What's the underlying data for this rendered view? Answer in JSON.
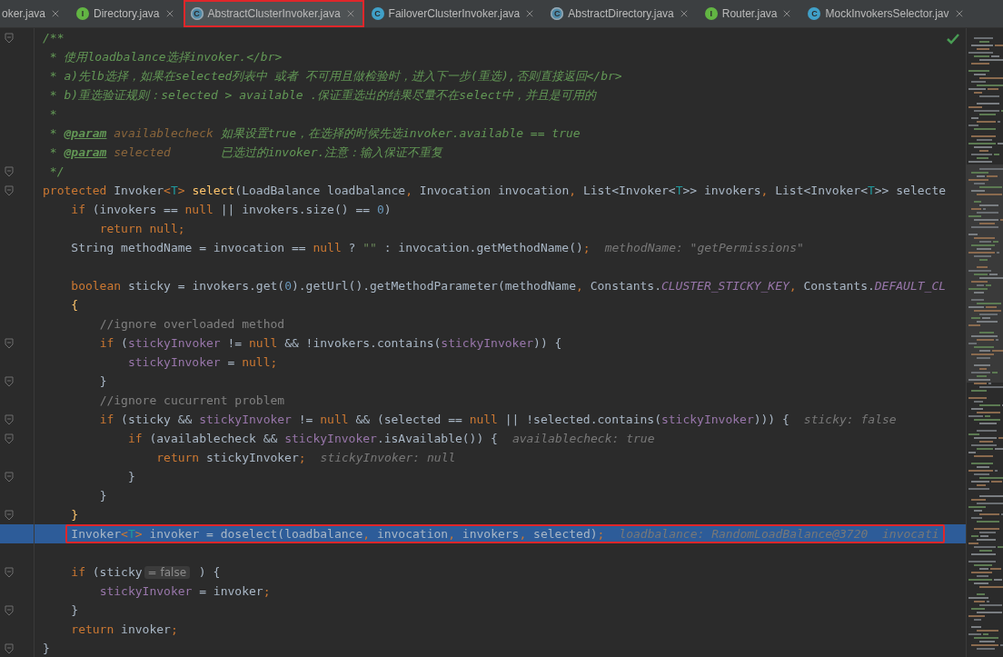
{
  "tabs": [
    {
      "label": "oker.java",
      "selected": false,
      "annotated": false
    },
    {
      "label": "Directory.java",
      "selected": false,
      "annotated": false,
      "icon": {
        "kind": "interface",
        "letter": "I"
      }
    },
    {
      "label": "AbstractClusterInvoker.java",
      "selected": true,
      "annotated": true,
      "icon": {
        "kind": "abstract-class",
        "letter": "C"
      }
    },
    {
      "label": "FailoverClusterInvoker.java",
      "selected": false,
      "annotated": false,
      "icon": {
        "kind": "class",
        "letter": "C"
      }
    },
    {
      "label": "AbstractDirectory.java",
      "selected": false,
      "annotated": false,
      "icon": {
        "kind": "abstract-class",
        "letter": "C"
      }
    },
    {
      "label": "Router.java",
      "selected": false,
      "annotated": false,
      "icon": {
        "kind": "interface",
        "letter": "I"
      }
    },
    {
      "label": "MockInvokersSelector.jav",
      "selected": false,
      "annotated": false,
      "icon": {
        "kind": "class",
        "letter": "C"
      }
    }
  ],
  "editor": {
    "analysis_ok": true,
    "lines": [
      {
        "fold": true,
        "current": false,
        "annotated": false,
        "tokens": [
          {
            "kind": "doc",
            "text": "/**"
          }
        ]
      },
      {
        "fold": false,
        "current": false,
        "annotated": false,
        "tokens": [
          {
            "kind": "doc",
            "text": " * 使用loadbalance选择invoker.</br>"
          }
        ]
      },
      {
        "fold": false,
        "current": false,
        "annotated": false,
        "tokens": [
          {
            "kind": "doc",
            "text": " * a)先lb选择，如果在selected列表中 或者 不可用且做检验时，进入下一步(重选),否则直接返回</br>"
          }
        ]
      },
      {
        "fold": false,
        "current": false,
        "annotated": false,
        "tokens": [
          {
            "kind": "doc",
            "text": " * b)重选验证规则：selected > available .保证重选出的结果尽量不在select中，并且是可用的"
          }
        ]
      },
      {
        "fold": false,
        "current": false,
        "annotated": false,
        "tokens": [
          {
            "kind": "doc",
            "text": " *"
          }
        ]
      },
      {
        "fold": false,
        "current": false,
        "annotated": false,
        "tokens": [
          {
            "kind": "doc",
            "text": " * "
          },
          {
            "kind": "doctag",
            "text": "@param"
          },
          {
            "kind": "docparam",
            "text": " availablecheck"
          },
          {
            "kind": "doc",
            "text": " 如果设置true，在选择的时候先选invoker.available == true"
          }
        ]
      },
      {
        "fold": false,
        "current": false,
        "annotated": false,
        "tokens": [
          {
            "kind": "doc",
            "text": " * "
          },
          {
            "kind": "doctag",
            "text": "@param"
          },
          {
            "kind": "docparam",
            "text": " selected"
          },
          {
            "kind": "doc",
            "text": "       已选过的invoker.注意：输入保证不重复"
          }
        ]
      },
      {
        "fold": true,
        "current": false,
        "annotated": false,
        "tokens": [
          {
            "kind": "doc",
            "text": " */"
          }
        ]
      },
      {
        "fold": true,
        "current": false,
        "annotated": false,
        "tokens": [
          {
            "kind": "kw",
            "text": "protected "
          },
          {
            "kind": "plain",
            "text": "Invoker"
          },
          {
            "kind": "kw",
            "text": "<"
          },
          {
            "kind": "tp",
            "text": "T"
          },
          {
            "kind": "kw",
            "text": "> "
          },
          {
            "kind": "method",
            "text": "select"
          },
          {
            "kind": "plain",
            "text": "(LoadBalance loadbalance"
          },
          {
            "kind": "kw",
            "text": ", "
          },
          {
            "kind": "plain",
            "text": "Invocation invocation"
          },
          {
            "kind": "kw",
            "text": ", "
          },
          {
            "kind": "plain",
            "text": "List<Invoker<"
          },
          {
            "kind": "tp",
            "text": "T"
          },
          {
            "kind": "plain",
            "text": ">> invokers"
          },
          {
            "kind": "kw",
            "text": ", "
          },
          {
            "kind": "plain",
            "text": "List<Invoker<"
          },
          {
            "kind": "tp",
            "text": "T"
          },
          {
            "kind": "plain",
            "text": ">> selecte"
          }
        ]
      },
      {
        "fold": false,
        "current": false,
        "annotated": false,
        "tokens": [
          {
            "kind": "kw",
            "text": "    if "
          },
          {
            "kind": "plain",
            "text": "(invokers == "
          },
          {
            "kind": "kw",
            "text": "null"
          },
          {
            "kind": "plain",
            "text": " || invokers.size() == "
          },
          {
            "kind": "num",
            "text": "0"
          },
          {
            "kind": "plain",
            "text": ")"
          }
        ]
      },
      {
        "fold": false,
        "current": false,
        "annotated": false,
        "tokens": [
          {
            "kind": "kw",
            "text": "        return null;"
          }
        ]
      },
      {
        "fold": false,
        "current": false,
        "annotated": false,
        "tokens": [
          {
            "kind": "plain",
            "text": "    String methodName = invocation == "
          },
          {
            "kind": "kw",
            "text": "null"
          },
          {
            "kind": "plain",
            "text": " ? "
          },
          {
            "kind": "str",
            "text": "\"\""
          },
          {
            "kind": "plain",
            "text": " : invocation.getMethodName()"
          },
          {
            "kind": "kw",
            "text": ";"
          },
          {
            "kind": "hint",
            "text": "methodName: \"getPermissions\""
          }
        ]
      },
      {
        "fold": false,
        "current": false,
        "annotated": false
      },
      {
        "fold": false,
        "current": false,
        "annotated": false,
        "tokens": [
          {
            "kind": "kw",
            "text": "    boolean "
          },
          {
            "kind": "plain",
            "text": "sticky = invokers.get("
          },
          {
            "kind": "num",
            "text": "0"
          },
          {
            "kind": "plain",
            "text": ").getUrl().getMethodParameter(methodName"
          },
          {
            "kind": "kw",
            "text": ", "
          },
          {
            "kind": "plain",
            "text": "Constants."
          },
          {
            "kind": "static",
            "text": "CLUSTER_STICKY_KEY"
          },
          {
            "kind": "kw",
            "text": ", "
          },
          {
            "kind": "plain",
            "text": "Constants."
          },
          {
            "kind": "static",
            "text": "DEFAULT_CL"
          }
        ]
      },
      {
        "fold": false,
        "current": false,
        "annotated": false,
        "tokens": [
          {
            "kind": "method",
            "text": "    {"
          }
        ]
      },
      {
        "fold": false,
        "current": false,
        "annotated": false,
        "tokens": [
          {
            "kind": "comment",
            "text": "        //ignore overloaded method"
          }
        ]
      },
      {
        "fold": true,
        "current": false,
        "annotated": false,
        "tokens": [
          {
            "kind": "kw",
            "text": "        if "
          },
          {
            "kind": "plain",
            "text": "("
          },
          {
            "kind": "field",
            "text": "stickyInvoker"
          },
          {
            "kind": "plain",
            "text": " != "
          },
          {
            "kind": "kw",
            "text": "null"
          },
          {
            "kind": "plain",
            "text": " && !invokers.contains("
          },
          {
            "kind": "field",
            "text": "stickyInvoker"
          },
          {
            "kind": "plain",
            "text": ")) {"
          }
        ]
      },
      {
        "fold": false,
        "current": false,
        "annotated": false,
        "tokens": [
          {
            "kind": "field",
            "text": "            stickyInvoker"
          },
          {
            "kind": "plain",
            "text": " = "
          },
          {
            "kind": "kw",
            "text": "null;"
          }
        ]
      },
      {
        "fold": true,
        "current": false,
        "annotated": false,
        "tokens": [
          {
            "kind": "plain",
            "text": "        }"
          }
        ]
      },
      {
        "fold": false,
        "current": false,
        "annotated": false,
        "tokens": [
          {
            "kind": "comment",
            "text": "        //ignore cucurrent problem"
          }
        ]
      },
      {
        "fold": true,
        "current": false,
        "annotated": false,
        "tokens": [
          {
            "kind": "kw",
            "text": "        if "
          },
          {
            "kind": "plain",
            "text": "(sticky && "
          },
          {
            "kind": "field",
            "text": "stickyInvoker"
          },
          {
            "kind": "plain",
            "text": " != "
          },
          {
            "kind": "kw",
            "text": "null"
          },
          {
            "kind": "plain",
            "text": " && (selected == "
          },
          {
            "kind": "kw",
            "text": "null"
          },
          {
            "kind": "plain",
            "text": " || !selected.contains("
          },
          {
            "kind": "field",
            "text": "stickyInvoker"
          },
          {
            "kind": "plain",
            "text": "))) {"
          },
          {
            "kind": "hint",
            "text": "sticky: false"
          }
        ]
      },
      {
        "fold": true,
        "current": false,
        "annotated": false,
        "tokens": [
          {
            "kind": "kw",
            "text": "            if "
          },
          {
            "kind": "plain",
            "text": "(availablecheck && "
          },
          {
            "kind": "field",
            "text": "stickyInvoker"
          },
          {
            "kind": "plain",
            "text": ".isAvailable()) {"
          },
          {
            "kind": "hint",
            "text": "availablecheck: true"
          }
        ]
      },
      {
        "fold": false,
        "current": false,
        "annotated": false,
        "tokens": [
          {
            "kind": "kw",
            "text": "                return "
          },
          {
            "kind": "plain",
            "text": "stickyInvoker"
          },
          {
            "kind": "kw",
            "text": ";"
          },
          {
            "kind": "hint",
            "text": "stickyInvoker: null"
          }
        ]
      },
      {
        "fold": true,
        "current": false,
        "annotated": false,
        "tokens": [
          {
            "kind": "plain",
            "text": "            }"
          }
        ]
      },
      {
        "fold": false,
        "current": false,
        "annotated": false,
        "tokens": [
          {
            "kind": "plain",
            "text": "        }"
          }
        ]
      },
      {
        "fold": true,
        "current": false,
        "annotated": false,
        "tokens": [
          {
            "kind": "method",
            "text": "    }"
          }
        ]
      },
      {
        "fold": false,
        "current": true,
        "annotated": true,
        "tokens": [
          {
            "kind": "plain",
            "text": "    Invoker"
          },
          {
            "kind": "kw",
            "text": "<"
          },
          {
            "kind": "tp",
            "text": "T"
          },
          {
            "kind": "kw",
            "text": "> "
          },
          {
            "kind": "plain",
            "text": "invoker = doselect(loadbalance"
          },
          {
            "kind": "kw",
            "text": ", "
          },
          {
            "kind": "plain",
            "text": "invocation"
          },
          {
            "kind": "kw",
            "text": ", "
          },
          {
            "kind": "plain",
            "text": "invokers"
          },
          {
            "kind": "kw",
            "text": ", "
          },
          {
            "kind": "plain",
            "text": "selected)"
          },
          {
            "kind": "kw",
            "text": ";"
          },
          {
            "kind": "hint",
            "text": "loadbalance: RandomLoadBalance@3720  invocati"
          }
        ]
      },
      {
        "fold": false,
        "current": false,
        "annotated": false
      },
      {
        "fold": true,
        "current": false,
        "annotated": false,
        "tokens": [
          {
            "kind": "kw",
            "text": "    if "
          },
          {
            "kind": "plain",
            "text": "(sticky"
          },
          {
            "kind": "badge",
            "text": "= false"
          },
          {
            "kind": "plain",
            "text": " ) {"
          }
        ]
      },
      {
        "fold": false,
        "current": false,
        "annotated": false,
        "tokens": [
          {
            "kind": "field",
            "text": "        stickyInvoker"
          },
          {
            "kind": "plain",
            "text": " = invoker"
          },
          {
            "kind": "kw",
            "text": ";"
          }
        ]
      },
      {
        "fold": true,
        "current": false,
        "annotated": false,
        "tokens": [
          {
            "kind": "plain",
            "text": "    }"
          }
        ]
      },
      {
        "fold": false,
        "current": false,
        "annotated": false,
        "tokens": [
          {
            "kind": "kw",
            "text": "    return "
          },
          {
            "kind": "plain",
            "text": "invoker"
          },
          {
            "kind": "kw",
            "text": ";"
          }
        ]
      },
      {
        "fold": true,
        "current": false,
        "annotated": false,
        "tokens": [
          {
            "kind": "plain",
            "text": "}"
          }
        ]
      }
    ]
  }
}
